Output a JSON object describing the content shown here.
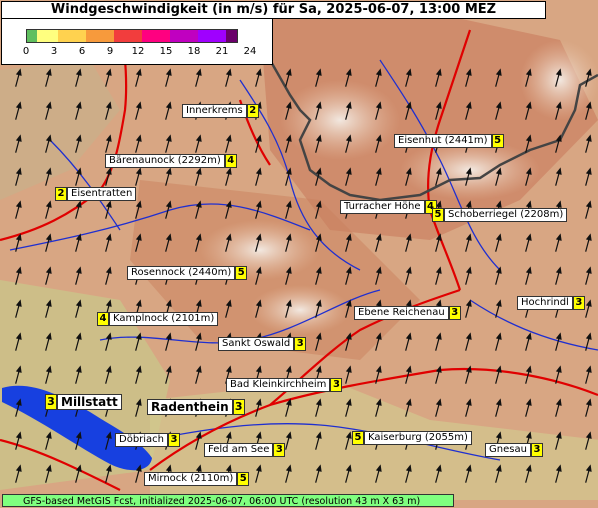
{
  "title": "Windgeschwindigkeit (in m/s) für Sa, 2025-06-07, 13:00 MEZ",
  "legend": {
    "ticks": [
      "0",
      "3",
      "6",
      "9",
      "12",
      "15",
      "18",
      "21",
      "24"
    ],
    "colors": [
      "#5fbf5f",
      "#ffff7f",
      "#ffd24f",
      "#f79a3c",
      "#f23d3d",
      "#ff0080",
      "#c000c0",
      "#9f00ff",
      "#6a006a"
    ]
  },
  "locations": [
    {
      "name": "Innerkrems",
      "value": "2"
    },
    {
      "name": "Bärenaunock (2292m)",
      "value": "4"
    },
    {
      "name": "Eisenhut (2441m)",
      "value": "5"
    },
    {
      "name": "Eisentratten",
      "value": "2"
    },
    {
      "name": "Turracher Höhe",
      "value": "4"
    },
    {
      "name": "Schoberriegel (2208m)",
      "value": "5"
    },
    {
      "name": "Rosennock (2440m)",
      "value": "5"
    },
    {
      "name": "Hochrindl",
      "value": "3"
    },
    {
      "name": "Kamplnock (2101m)",
      "value": "4"
    },
    {
      "name": "Ebene Reichenau",
      "value": "3"
    },
    {
      "name": "Sankt Oswald",
      "value": "3"
    },
    {
      "name": "Bad Kleinkirchheim",
      "value": "3"
    },
    {
      "name": "Millstatt",
      "value": "3"
    },
    {
      "name": "Radenthein",
      "value": "3"
    },
    {
      "name": "Döbriach",
      "value": "3"
    },
    {
      "name": "Feld am See",
      "value": "3"
    },
    {
      "name": "Kaiserburg (2055m)",
      "value": "5"
    },
    {
      "name": "Gnesau",
      "value": "3"
    },
    {
      "name": "Mirnock (2110m)",
      "value": "5"
    }
  ],
  "footer": "GFS-based MetGIS Fcst, initialized 2025-06-07, 06:00 UTC  (resolution 43 m X 63 m)",
  "colors": {
    "terrain": "#d9a07c",
    "lake": "#1740e0",
    "roads": "#e00000",
    "rivers": "#1f2fd0",
    "border": "#444444"
  },
  "icons": [
    "wind-arrow-icon"
  ]
}
